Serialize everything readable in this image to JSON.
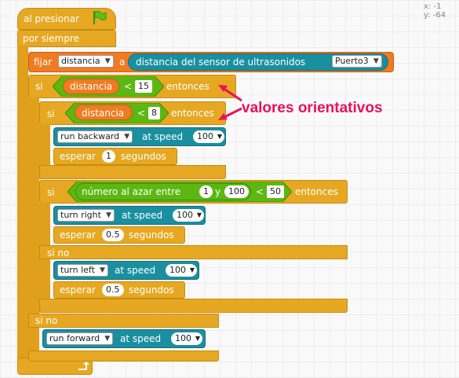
{
  "coords": {
    "x_label": "x:",
    "x_value": "-1",
    "y_label": "y:",
    "y_value": "-64"
  },
  "script": {
    "hat_label": "al presionar",
    "forever_label": "por siempre",
    "set": {
      "label": "fijar",
      "var": "distancia",
      "a_label": "a",
      "sensor_label": "distancia del sensor de ultrasonidos",
      "port": "Puerto3"
    },
    "if1": {
      "si": "si",
      "var": "distancia",
      "op": "<",
      "value": "15",
      "then": "entonces",
      "else": "si no"
    },
    "if2": {
      "si": "si",
      "var": "distancia",
      "op": "<",
      "value": "8",
      "then": "entonces"
    },
    "run_backward": {
      "dir": "run backward",
      "speed_label": "at speed",
      "speed": "100"
    },
    "wait1": {
      "label": "esperar",
      "value": "1",
      "unit": "segundos"
    },
    "if3": {
      "si": "si",
      "rand_label": "número al azar entre",
      "from": "1",
      "y_label": "y",
      "to": "100",
      "op": "<",
      "value": "50",
      "then": "entonces",
      "else": "si no"
    },
    "turn_right": {
      "dir": "turn right",
      "speed_label": "at speed",
      "speed": "100"
    },
    "wait2": {
      "label": "esperar",
      "value": "0.5",
      "unit": "segundos"
    },
    "turn_left": {
      "dir": "turn left",
      "speed_label": "at speed",
      "speed": "100"
    },
    "wait3": {
      "label": "esperar",
      "value": "0.5",
      "unit": "segundos"
    },
    "run_forward": {
      "dir": "run forward",
      "speed_label": "at speed",
      "speed": "100"
    }
  },
  "annotation": {
    "text": "valores orientativos",
    "color": "#e8125a"
  },
  "colors": {
    "control": "#e6a823",
    "variable": "#ef7b22",
    "operator": "#5cb712",
    "sensor": "#1a8fa0"
  },
  "icons": {
    "flag": "green-flag-icon",
    "loop": "loop-arrow-icon",
    "dropdown": "dropdown-arrow-icon"
  }
}
